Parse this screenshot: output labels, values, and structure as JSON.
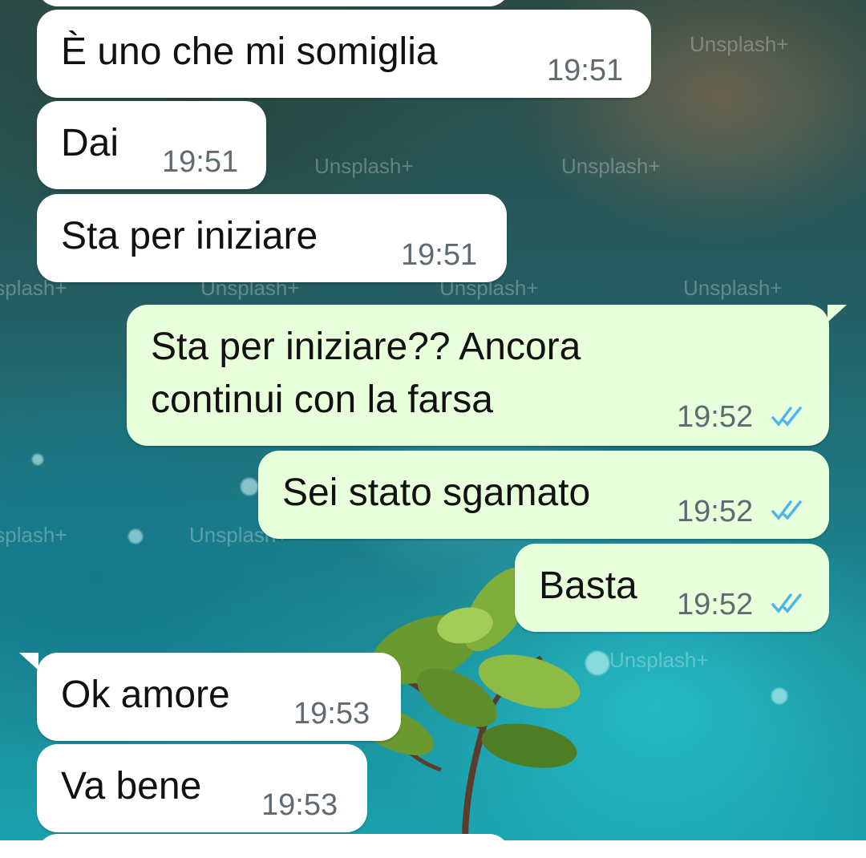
{
  "wallpaper": {
    "watermark_text": "Unsplash+"
  },
  "messages": [
    {
      "id": "m1",
      "direction": "incoming",
      "text": "È uno che mi somiglia",
      "time": "19:51"
    },
    {
      "id": "m2",
      "direction": "incoming",
      "text": "Dai",
      "time": "19:51"
    },
    {
      "id": "m3",
      "direction": "incoming",
      "text": "Sta per iniziare",
      "time": "19:51"
    },
    {
      "id": "m4",
      "direction": "outgoing",
      "text_line1": "Sta per iniziare?? Ancora",
      "text_line2": "continui con la farsa",
      "time": "19:52",
      "status": "read"
    },
    {
      "id": "m5",
      "direction": "outgoing",
      "text": "Sei stato sgamato",
      "time": "19:52",
      "status": "read"
    },
    {
      "id": "m6",
      "direction": "outgoing",
      "text": "Basta",
      "time": "19:52",
      "status": "read"
    },
    {
      "id": "m7",
      "direction": "incoming",
      "text": "Ok amore",
      "time": "19:53"
    },
    {
      "id": "m8",
      "direction": "incoming",
      "text": "Va bene",
      "time": "19:53"
    }
  ],
  "colors": {
    "incoming_bubble": "#ffffff",
    "outgoing_bubble": "#e7ffdb",
    "read_tick": "#4fb6ec",
    "time_text": "#5f6b71"
  },
  "icons": {
    "read_receipt": "double-check-icon"
  }
}
